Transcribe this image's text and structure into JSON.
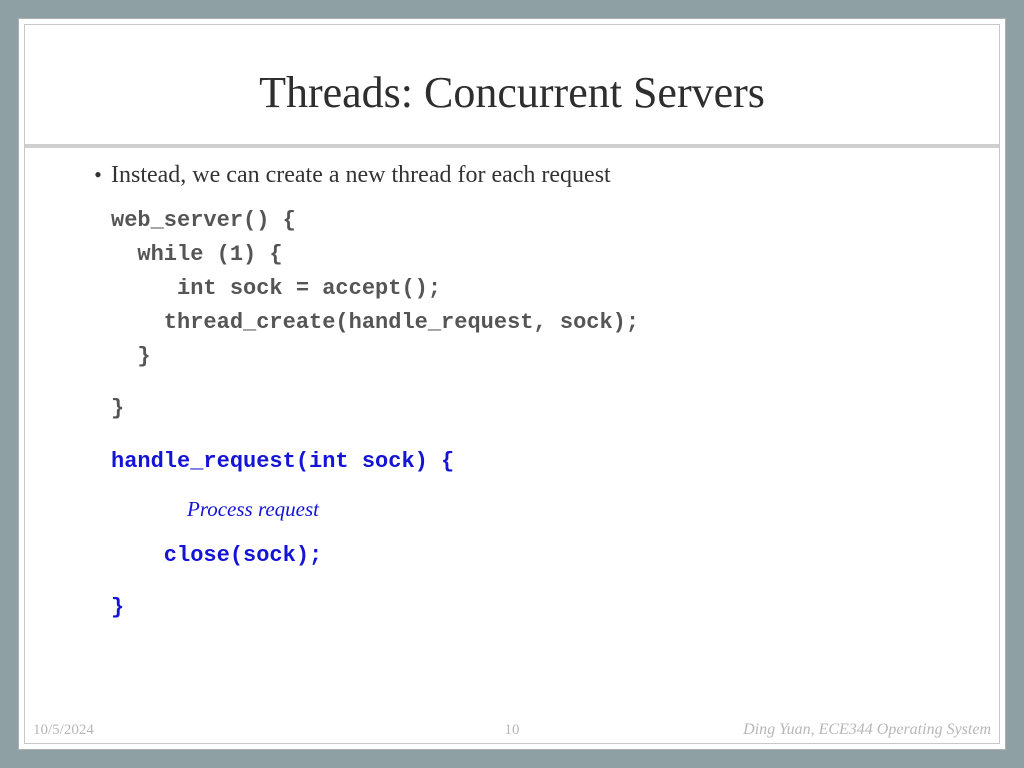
{
  "slide": {
    "title": "Threads: Concurrent Servers",
    "bullet": "Instead, we can create a new thread for each request",
    "code": {
      "l1": "web_server() {",
      "l2": "  while (1) {",
      "l3": "     int sock = accept();",
      "l4": "    thread_create(handle_request, sock);",
      "l5": "  }",
      "l6": "}",
      "l7": "handle_request(int sock) {",
      "note": "Process request",
      "l8": "    close(sock);",
      "l9": "}"
    }
  },
  "footer": {
    "date": "10/5/2024",
    "page": "10",
    "credit": "Ding Yuan, ECE344 Operating System"
  }
}
